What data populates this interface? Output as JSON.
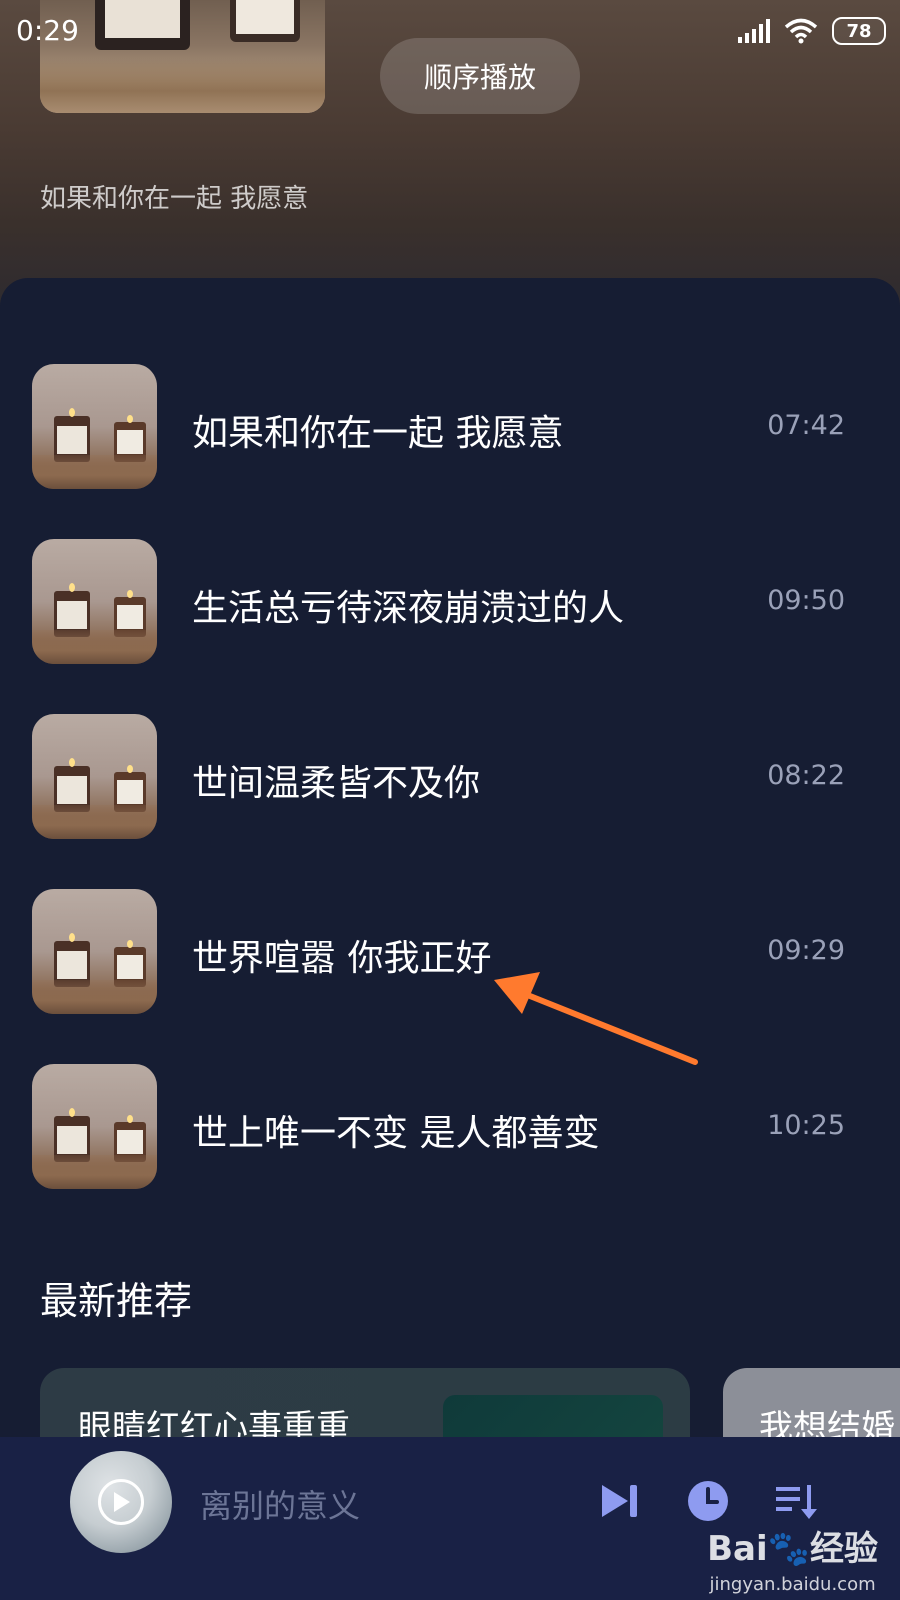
{
  "status_bar": {
    "time": "0:29",
    "battery": "78"
  },
  "header": {
    "play_mode": "顺序播放",
    "album_subtitle": "如果和你在一起 我愿意"
  },
  "tracks": [
    {
      "title": "如果和你在一起 我愿意",
      "duration": "07:42"
    },
    {
      "title": "生活总亏待深夜崩溃过的人",
      "duration": "09:50"
    },
    {
      "title": "世间温柔皆不及你",
      "duration": "08:22"
    },
    {
      "title": "世界喧嚣 你我正好",
      "duration": "09:29"
    },
    {
      "title": "世上唯一不变 是人都善变",
      "duration": "10:25"
    }
  ],
  "recommend": {
    "title": "最新推荐",
    "cards": [
      {
        "title": "眼睛红红心事重重"
      },
      {
        "title": "我想结婚"
      }
    ]
  },
  "player": {
    "title": "离别的意义"
  },
  "watermark": {
    "brand": "Bai🐾经验",
    "url": "jingyan.baidu.com"
  },
  "colors": {
    "panel_bg": "#161d33",
    "player_bg": "#192145",
    "accent_icon": "#8e9bf0",
    "arrow": "#ff7a2e"
  }
}
